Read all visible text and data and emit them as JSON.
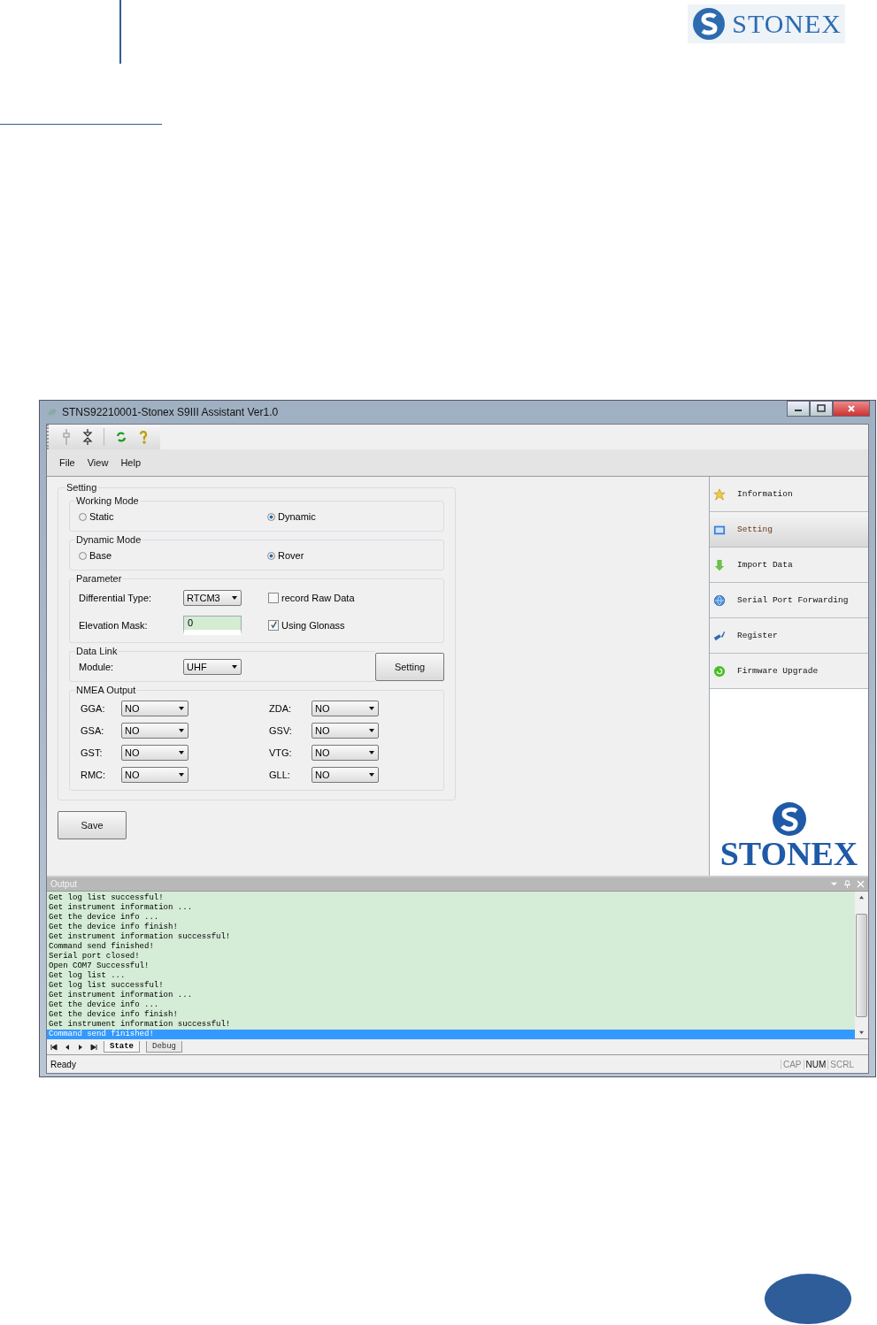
{
  "header": {
    "logo": "STONEX"
  },
  "window": {
    "title": "STNS92210001-Stonex S9III Assistant Ver1.0"
  },
  "menu": [
    "File",
    "View",
    "Help"
  ],
  "setting": {
    "title": "Setting",
    "working_mode": {
      "title": "Working Mode",
      "options": [
        {
          "label": "Static",
          "selected": false
        },
        {
          "label": "Dynamic",
          "selected": true
        }
      ]
    },
    "dynamic_mode": {
      "title": "Dynamic Mode",
      "options": [
        {
          "label": "Base",
          "selected": false
        },
        {
          "label": "Rover",
          "selected": true
        }
      ]
    },
    "parameter": {
      "title": "Parameter",
      "differential_type": {
        "label": "Differential Type:",
        "value": "RTCM3"
      },
      "record_raw_data": {
        "label": "record Raw Data",
        "checked": false
      },
      "elevation_mask": {
        "label": "Elevation Mask:",
        "value": "0"
      },
      "using_glonass": {
        "label": "Using Glonass",
        "checked": true
      }
    },
    "data_link": {
      "title": "Data Link",
      "module": {
        "label": "Module:",
        "value": "UHF"
      },
      "button": "Setting"
    },
    "nmea_output": {
      "title": "NMEA Output",
      "items": [
        {
          "label": "GGA:",
          "value": "NO"
        },
        {
          "label": "ZDA:",
          "value": "NO"
        },
        {
          "label": "GSA:",
          "value": "NO"
        },
        {
          "label": "GSV:",
          "value": "NO"
        },
        {
          "label": "GST:",
          "value": "NO"
        },
        {
          "label": "VTG:",
          "value": "NO"
        },
        {
          "label": "RMC:",
          "value": "NO"
        },
        {
          "label": "GLL:",
          "value": "NO"
        }
      ]
    },
    "save_button": "Save"
  },
  "nav": {
    "items": [
      {
        "label": "Information",
        "kind": "star",
        "selected": false
      },
      {
        "label": "Setting",
        "kind": "monitor",
        "selected": true
      },
      {
        "label": "Import Data",
        "kind": "arrow",
        "selected": false
      },
      {
        "label": "Serial Port Forwarding",
        "kind": "globe",
        "selected": false
      },
      {
        "label": "Register",
        "kind": "tool",
        "selected": false
      },
      {
        "label": "Firmware Upgrade",
        "kind": "circle",
        "selected": false
      }
    ],
    "logo": "STONEX"
  },
  "output": {
    "title": "Output",
    "lines": [
      {
        "text": "Get log list successful!",
        "selected": false
      },
      {
        "text": "Get instrument information ...",
        "selected": false
      },
      {
        "text": "Get the device info ...",
        "selected": false
      },
      {
        "text": "Get the device info finish!",
        "selected": false
      },
      {
        "text": "Get instrument information successful!",
        "selected": false
      },
      {
        "text": "Command send finished!",
        "selected": false
      },
      {
        "text": "Serial port closed!",
        "selected": false
      },
      {
        "text": "Open COM7 Successful!",
        "selected": false
      },
      {
        "text": "Get log list ...",
        "selected": false
      },
      {
        "text": "Get log list successful!",
        "selected": false
      },
      {
        "text": "Get instrument information ...",
        "selected": false
      },
      {
        "text": "Get the device info ...",
        "selected": false
      },
      {
        "text": "Get the device info finish!",
        "selected": false
      },
      {
        "text": "Get instrument information successful!",
        "selected": false
      },
      {
        "text": "Command send finished!",
        "selected": true
      }
    ],
    "tabs": [
      {
        "label": "State",
        "selected": true
      },
      {
        "label": "Debug",
        "selected": false
      }
    ]
  },
  "status_bar": {
    "text": "Ready",
    "indicators": [
      {
        "label": "CAP",
        "on": false
      },
      {
        "label": "NUM",
        "on": true
      },
      {
        "label": "SCRL",
        "on": false
      }
    ]
  }
}
